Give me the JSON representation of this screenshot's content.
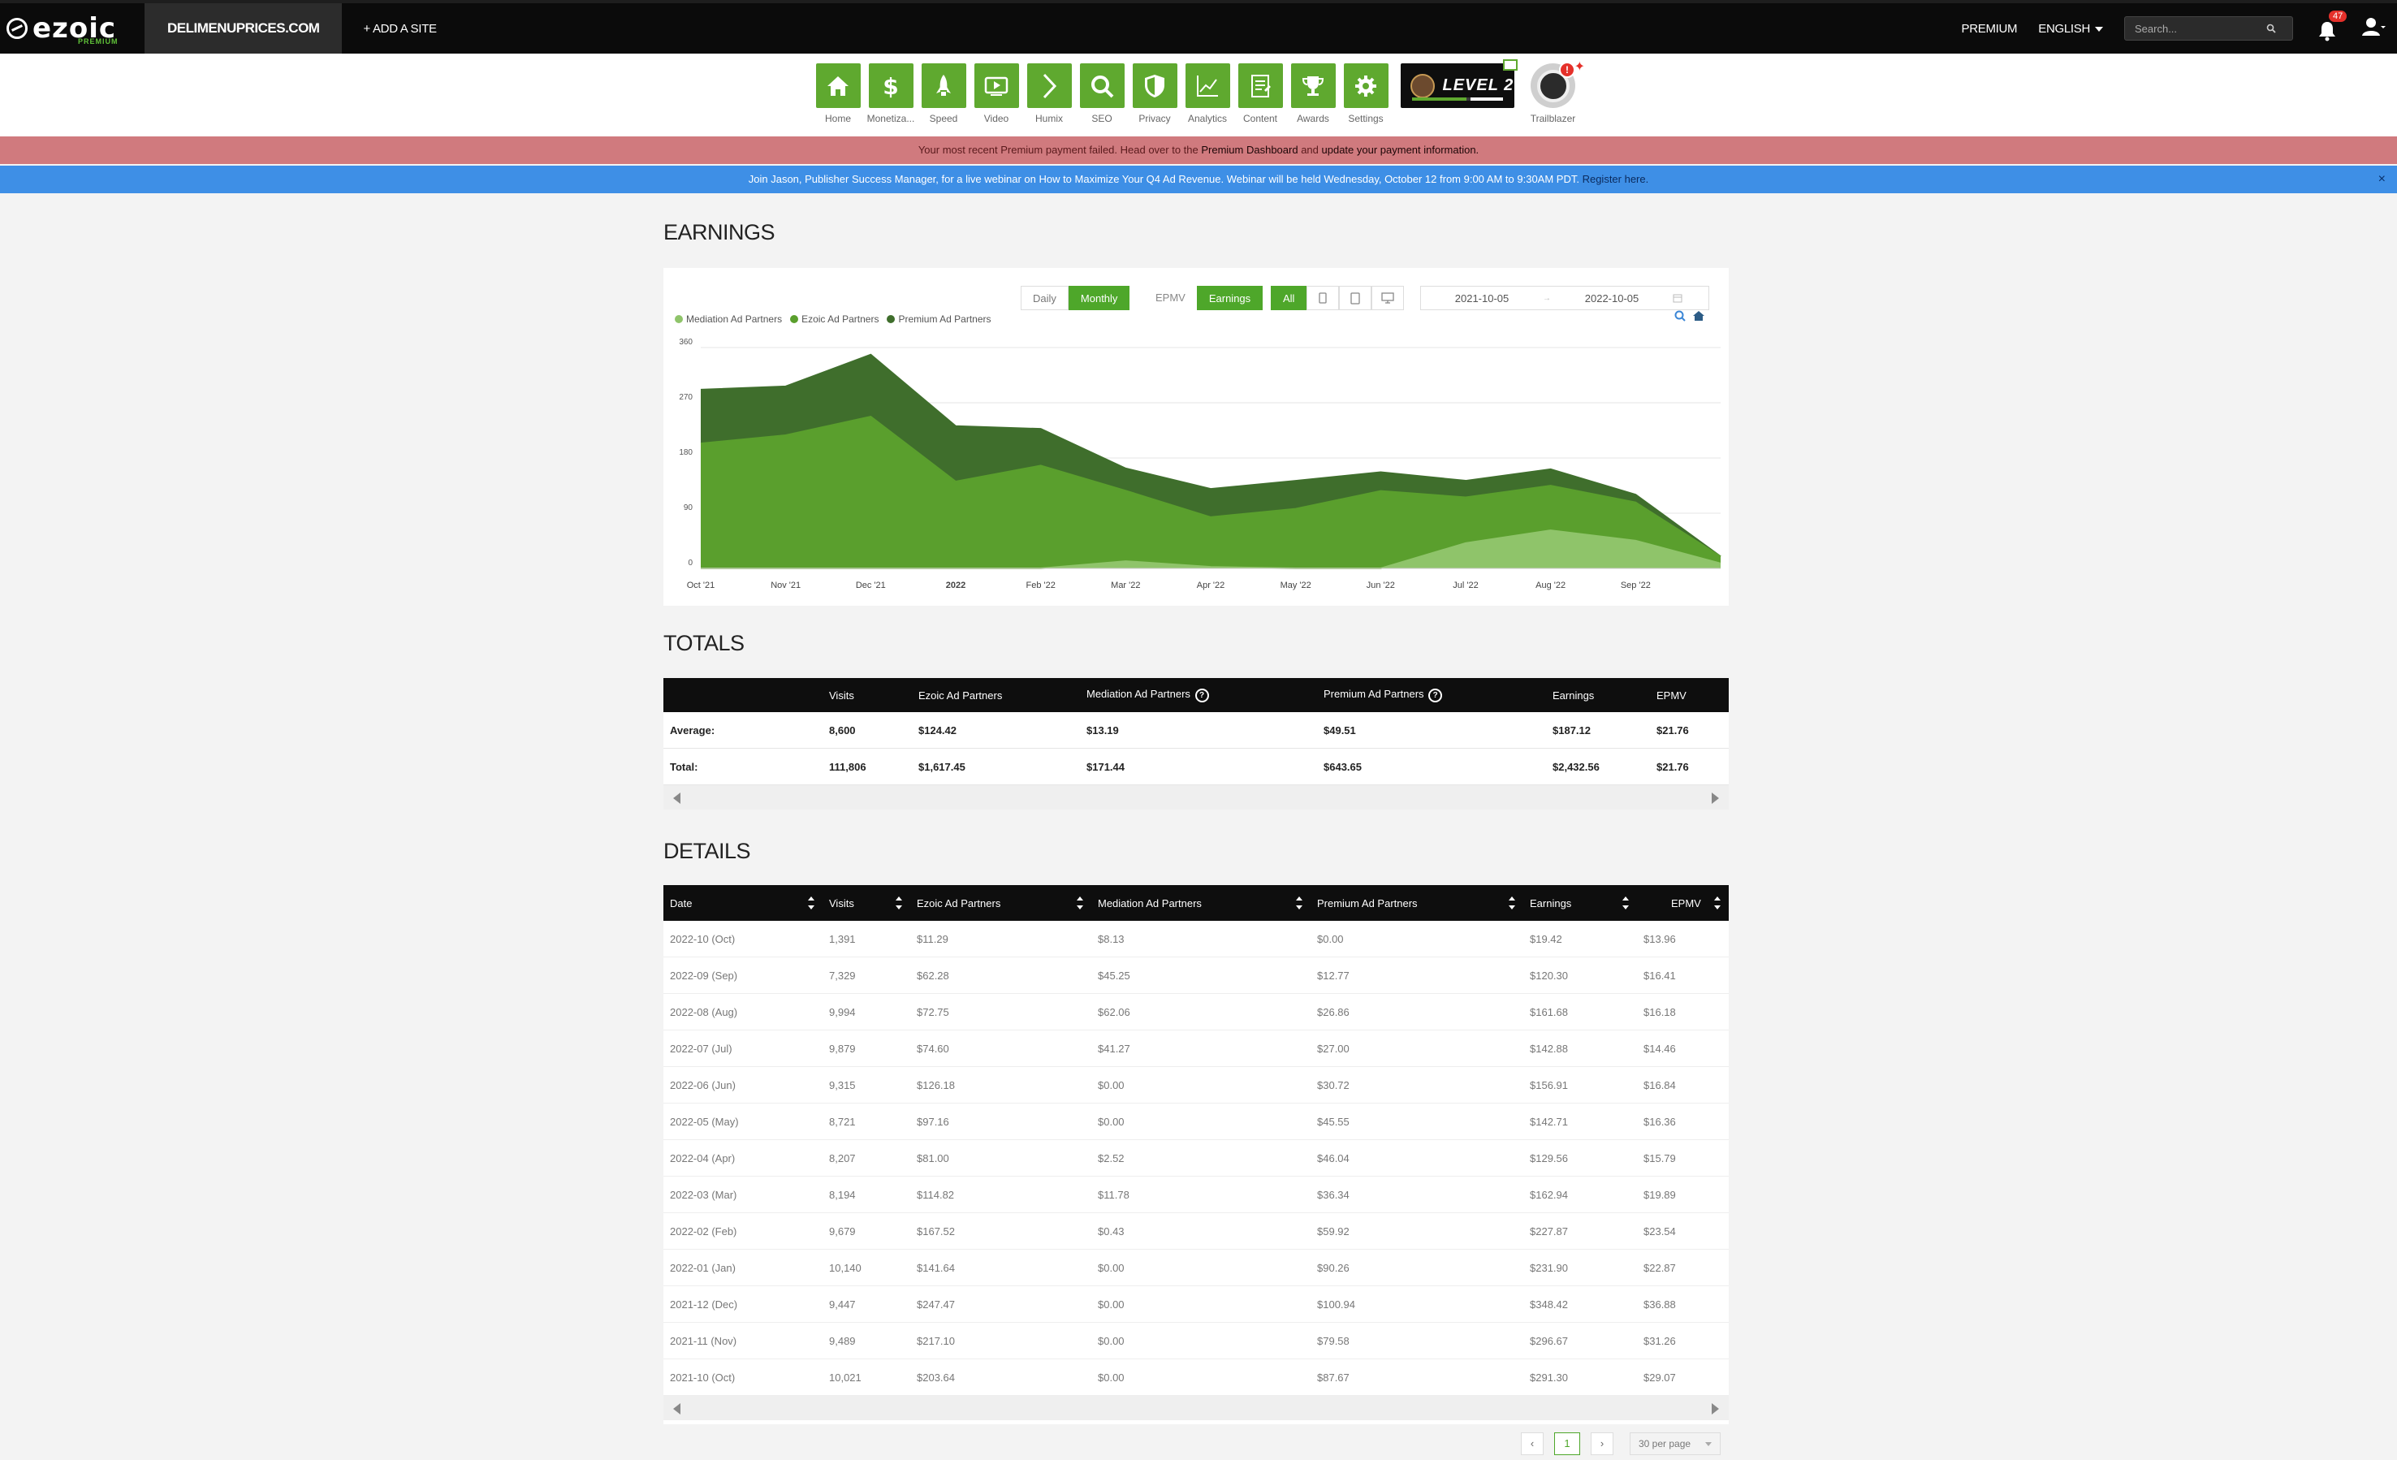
{
  "brand": {
    "name": "ezoic",
    "sub": "PREMIUM"
  },
  "topbar": {
    "site": "DELIMENUPRICES.COM",
    "add_site": "+ ADD A SITE",
    "premium": "PREMIUM",
    "language": "ENGLISH",
    "search_placeholder": "Search...",
    "notifications": "47"
  },
  "nav": {
    "items": [
      {
        "label": "Home",
        "icon": "home-icon"
      },
      {
        "label": "Monetiza...",
        "icon": "dollar-icon"
      },
      {
        "label": "Speed",
        "icon": "rocket-icon"
      },
      {
        "label": "Video",
        "icon": "video-icon"
      },
      {
        "label": "Humix",
        "icon": "chevron-right-icon"
      },
      {
        "label": "SEO",
        "icon": "magnifier-icon"
      },
      {
        "label": "Privacy",
        "icon": "shield-icon"
      },
      {
        "label": "Analytics",
        "icon": "line-chart-icon"
      },
      {
        "label": "Content",
        "icon": "document-icon"
      },
      {
        "label": "Awards",
        "icon": "trophy-icon"
      },
      {
        "label": "Settings",
        "icon": "gear-icon"
      }
    ],
    "level": "LEVEL 2",
    "trailblazer": "Trailblazer",
    "trailblazer_badge": "!"
  },
  "alerts": {
    "payment_pre": "Your most recent Premium payment failed. Head over to the ",
    "payment_link": "Premium Dashboard",
    "payment_mid": " and ",
    "payment_link2": "update your payment information.",
    "webinar": "Join Jason, Publisher Success Manager, for a live webinar on How to Maximize Your Q4 Ad Revenue. Webinar will be held Wednesday, October 12 from 9:00 AM to 9:30AM PDT. ",
    "webinar_link": "Register here.",
    "close": "×"
  },
  "earnings": {
    "title": "EARNINGS",
    "controls": {
      "daily": "Daily",
      "monthly": "Monthly",
      "epmv": "EPMV",
      "earnings": "Earnings",
      "all": "All",
      "start_date": "2021-10-05",
      "end_date": "2022-10-05"
    }
  },
  "chart_data": {
    "type": "area",
    "stacked": true,
    "x": [
      "Oct '21",
      "Nov '21",
      "Dec '21",
      "2022",
      "Feb '22",
      "Mar '22",
      "Apr '22",
      "May '22",
      "Jun '22",
      "Jul '22",
      "Aug '22",
      "Sep '22",
      ""
    ],
    "xticks": [
      "Oct '21",
      "Nov '21",
      "Dec '21",
      "2022",
      "Feb '22",
      "Mar '22",
      "Apr '22",
      "May '22",
      "Jun '22",
      "Jul '22",
      "Aug '22",
      "Sep '22"
    ],
    "yticks": [
      "0",
      "90",
      "180",
      "270",
      "360"
    ],
    "ylim": [
      0,
      360
    ],
    "series": [
      {
        "name": "Mediation Ad Partners",
        "color": "#8fc46a",
        "values": [
          0,
          0,
          0,
          0,
          0,
          11.78,
          2.52,
          0,
          0,
          41.27,
          62.06,
          45.25,
          8.13
        ]
      },
      {
        "name": "Ezoic Ad Partners",
        "color": "#5a9f2d",
        "values": [
          203.64,
          217.1,
          247.47,
          141.64,
          167.52,
          114.82,
          81.0,
          97.16,
          126.18,
          74.6,
          72.75,
          62.28,
          11.29
        ]
      },
      {
        "name": "Premium Ad Partners",
        "color": "#3f6e2c",
        "values": [
          87.67,
          79.58,
          100.94,
          90.26,
          59.92,
          36.34,
          46.04,
          45.55,
          30.72,
          27.0,
          26.86,
          12.77,
          0
        ]
      }
    ]
  },
  "totals": {
    "title": "TOTALS",
    "headers": [
      "",
      "Visits",
      "Ezoic Ad Partners",
      "Mediation Ad Partners",
      "Premium Ad Partners",
      "Earnings",
      "EPMV"
    ],
    "rows": [
      [
        "Average:",
        "8,600",
        "$124.42",
        "$13.19",
        "$49.51",
        "$187.12",
        "$21.76"
      ],
      [
        "Total:",
        "111,806",
        "$1,617.45",
        "$171.44",
        "$643.65",
        "$2,432.56",
        "$21.76"
      ]
    ]
  },
  "details": {
    "title": "DETAILS",
    "headers": [
      "Date",
      "Visits",
      "Ezoic Ad Partners",
      "Mediation Ad Partners",
      "Premium Ad Partners",
      "Earnings",
      "EPMV"
    ],
    "rows": [
      [
        "2022-10 (Oct)",
        "1,391",
        "$11.29",
        "$8.13",
        "$0.00",
        "$19.42",
        "$13.96"
      ],
      [
        "2022-09 (Sep)",
        "7,329",
        "$62.28",
        "$45.25",
        "$12.77",
        "$120.30",
        "$16.41"
      ],
      [
        "2022-08 (Aug)",
        "9,994",
        "$72.75",
        "$62.06",
        "$26.86",
        "$161.68",
        "$16.18"
      ],
      [
        "2022-07 (Jul)",
        "9,879",
        "$74.60",
        "$41.27",
        "$27.00",
        "$142.88",
        "$14.46"
      ],
      [
        "2022-06 (Jun)",
        "9,315",
        "$126.18",
        "$0.00",
        "$30.72",
        "$156.91",
        "$16.84"
      ],
      [
        "2022-05 (May)",
        "8,721",
        "$97.16",
        "$0.00",
        "$45.55",
        "$142.71",
        "$16.36"
      ],
      [
        "2022-04 (Apr)",
        "8,207",
        "$81.00",
        "$2.52",
        "$46.04",
        "$129.56",
        "$15.79"
      ],
      [
        "2022-03 (Mar)",
        "8,194",
        "$114.82",
        "$11.78",
        "$36.34",
        "$162.94",
        "$19.89"
      ],
      [
        "2022-02 (Feb)",
        "9,679",
        "$167.52",
        "$0.43",
        "$59.92",
        "$227.87",
        "$23.54"
      ],
      [
        "2022-01 (Jan)",
        "10,140",
        "$141.64",
        "$0.00",
        "$90.26",
        "$231.90",
        "$22.87"
      ],
      [
        "2021-12 (Dec)",
        "9,447",
        "$247.47",
        "$0.00",
        "$100.94",
        "$348.42",
        "$36.88"
      ],
      [
        "2021-11 (Nov)",
        "9,489",
        "$217.10",
        "$0.00",
        "$79.58",
        "$296.67",
        "$31.26"
      ],
      [
        "2021-10 (Oct)",
        "10,021",
        "$203.64",
        "$0.00",
        "$87.67",
        "$291.30",
        "$29.07"
      ]
    ]
  },
  "pager": {
    "prev": "‹",
    "page": "1",
    "next": "›",
    "per_page": "30 per page"
  }
}
